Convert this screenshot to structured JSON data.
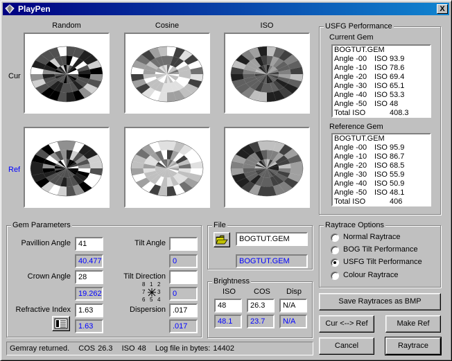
{
  "window": {
    "title": "PlayPen",
    "close_label": "X"
  },
  "columns": [
    "Random",
    "Cosine",
    "ISO"
  ],
  "rows": {
    "cur": "Cur",
    "ref": "Ref"
  },
  "performance": {
    "group_label": "USFG Performance",
    "current": {
      "label": "Current Gem",
      "file": "BOGTUT.GEM",
      "rows": [
        {
          "angle": "Angle -00",
          "metric": "ISO",
          "value": "93.9"
        },
        {
          "angle": "Angle -10",
          "metric": "ISO",
          "value": "78.6"
        },
        {
          "angle": "Angle -20",
          "metric": "ISO",
          "value": "69.4"
        },
        {
          "angle": "Angle -30",
          "metric": "ISO",
          "value": "65.1"
        },
        {
          "angle": "Angle -40",
          "metric": "ISO",
          "value": "53.3"
        },
        {
          "angle": "Angle -50",
          "metric": "ISO",
          "value": "48"
        }
      ],
      "total_label": "Total ISO",
      "total": "408.3"
    },
    "reference": {
      "label": "Reference Gem",
      "file": "BOGTUT.GEM",
      "rows": [
        {
          "angle": "Angle -00",
          "metric": "ISO",
          "value": "95.9"
        },
        {
          "angle": "Angle -10",
          "metric": "ISO",
          "value": "86.7"
        },
        {
          "angle": "Angle -20",
          "metric": "ISO",
          "value": "68.5"
        },
        {
          "angle": "Angle -30",
          "metric": "ISO",
          "value": "55.9"
        },
        {
          "angle": "Angle -40",
          "metric": "ISO",
          "value": "50.9"
        },
        {
          "angle": "Angle -50",
          "metric": "ISO",
          "value": "48.1"
        }
      ],
      "total_label": "Total ISO",
      "total": "406"
    }
  },
  "gem_params": {
    "group_label": "Gem Parameters",
    "pavilion_label": "Pavillion Angle",
    "pavilion_value": "41",
    "pavilion_calc": "40.477",
    "crown_label": "Crown Angle",
    "crown_value": "28",
    "crown_calc": "19.262",
    "ri_label": "Refractive Index",
    "ri_value": "1.63",
    "ri_calc": "1.63",
    "tilt_label": "Tilt Angle",
    "tilt_value": "",
    "tilt_calc": "0",
    "tiltdir_label": "Tilt Direction",
    "tiltdir_value": "",
    "tiltdir_calc": "0",
    "compass": {
      "n": [
        "8",
        "1",
        "2"
      ],
      "m": [
        "7",
        "3"
      ],
      "s": [
        "6",
        "5",
        "4"
      ]
    },
    "disp_label": "Dispersion",
    "disp_value": ".017",
    "disp_calc": ".017"
  },
  "file": {
    "group_label": "File",
    "value": "BOGTUT.GEM",
    "loaded": "BOGTUT.GEM"
  },
  "brightness": {
    "group_label": "Brightness",
    "headers": [
      "ISO",
      "COS",
      "Disp"
    ],
    "values": [
      "48",
      "26.3",
      "N/A"
    ],
    "ref_values": [
      "48.1",
      "23.7",
      "N/A"
    ]
  },
  "raytrace": {
    "group_label": "Raytrace Options",
    "options": [
      "Normal Raytrace",
      "BOG Tilt Performance",
      "USFG Tilt Performance",
      "Colour Raytrace"
    ],
    "selected": 2
  },
  "buttons": {
    "save_bmp": "Save Raytraces as BMP",
    "swap": "Cur <--> Ref",
    "make_ref": "Make Ref",
    "cancel": "Cancel",
    "raytrace": "Raytrace"
  },
  "status": {
    "msg": "Gemray returned.",
    "cos_label": "COS",
    "cos_value": "26.3",
    "iso_label": "ISO",
    "iso_value": "48",
    "log_label": "Log file in bytes:",
    "log_value": "14402"
  }
}
